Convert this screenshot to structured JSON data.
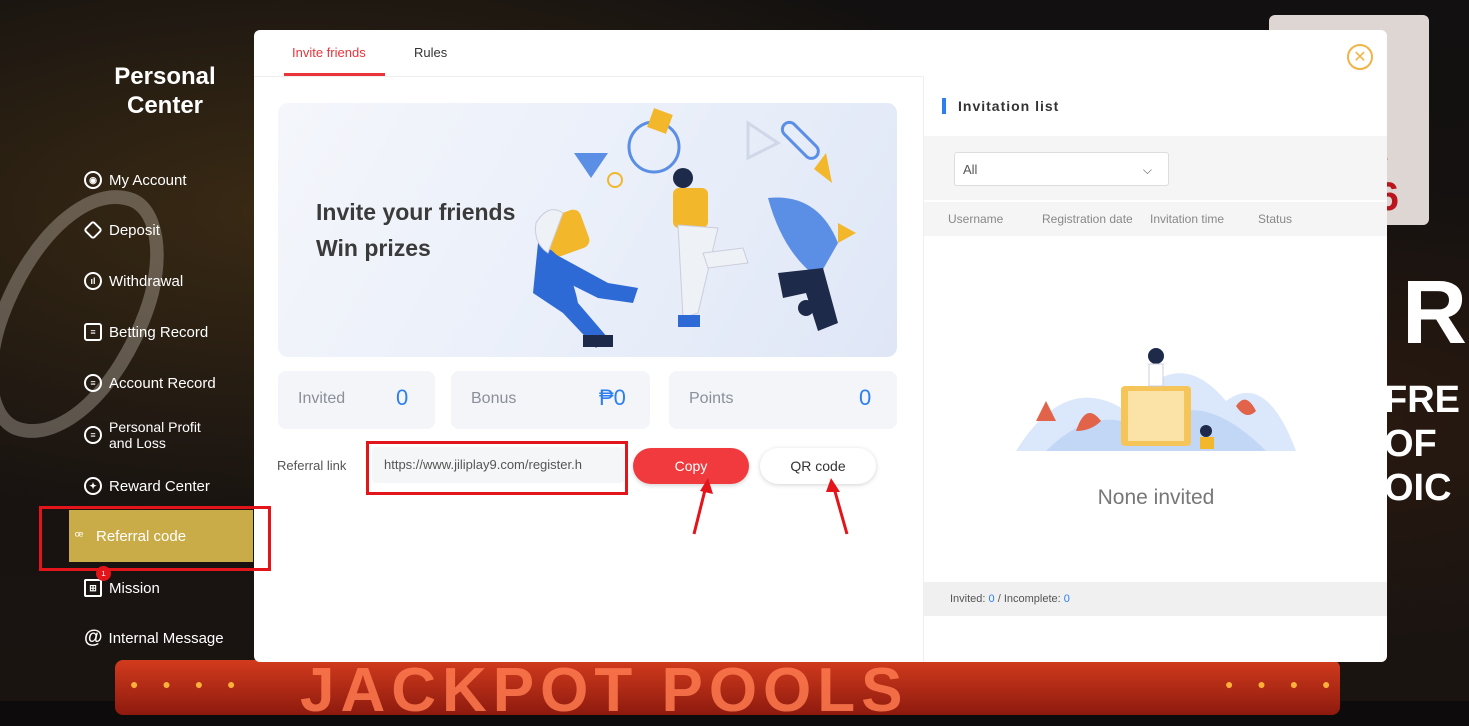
{
  "sidebar": {
    "title_line1": "Personal",
    "title_line2": "Center",
    "items": [
      {
        "label": "My Account",
        "icon": "account-icon"
      },
      {
        "label": "Deposit",
        "icon": "deposit-icon"
      },
      {
        "label": "Withdrawal",
        "icon": "withdrawal-icon"
      },
      {
        "label": "Betting Record",
        "icon": "betting-record-icon"
      },
      {
        "label": "Account Record",
        "icon": "account-record-icon"
      },
      {
        "label_line1": "Personal Profit",
        "label_line2": "and Loss",
        "icon": "profit-loss-icon"
      },
      {
        "label": "Reward Center",
        "icon": "reward-icon"
      },
      {
        "label": "Referral code",
        "icon": "referral-icon",
        "active": true
      },
      {
        "label": "Mission",
        "icon": "gift-icon",
        "badge": "1"
      },
      {
        "label": "Internal Message",
        "icon": "at-icon"
      }
    ]
  },
  "modal": {
    "tabs": [
      "Invite friends",
      "Rules"
    ],
    "active_tab": "Invite friends",
    "banner": {
      "line1": "Invite your friends",
      "line2": "Win prizes"
    },
    "stats": {
      "invited_label": "Invited",
      "invited_value": "0",
      "bonus_label": "Bonus",
      "bonus_value": "₱0",
      "points_label": "Points",
      "points_value": "0"
    },
    "referral": {
      "label": "Referral link",
      "link": "https://www.jiliplay9.com/register.h",
      "copy_label": "Copy",
      "qr_label": "QR code"
    },
    "invitation_list": {
      "title": "Invitation list",
      "filter_value": "All",
      "columns": [
        "Username",
        "Registration date",
        "Invitation time",
        "Status"
      ],
      "empty_text": "None invited",
      "footer_invited_label": "Invited:",
      "footer_invited_value": "0",
      "footer_sep": "/",
      "footer_incomplete_label": "Incomplete:",
      "footer_incomplete_value": "0"
    }
  },
  "background": {
    "card_number": "6",
    "right_letter": "R",
    "right_text_lines": [
      "FRE",
      "OF",
      "OIC"
    ],
    "bottom_text": "JACKPOT POOLS"
  },
  "colors": {
    "accent_red": "#f03a3e",
    "active_gold": "#c9ac47",
    "link_blue": "#2d7ff0",
    "highlight_outline": "#e3141a"
  }
}
